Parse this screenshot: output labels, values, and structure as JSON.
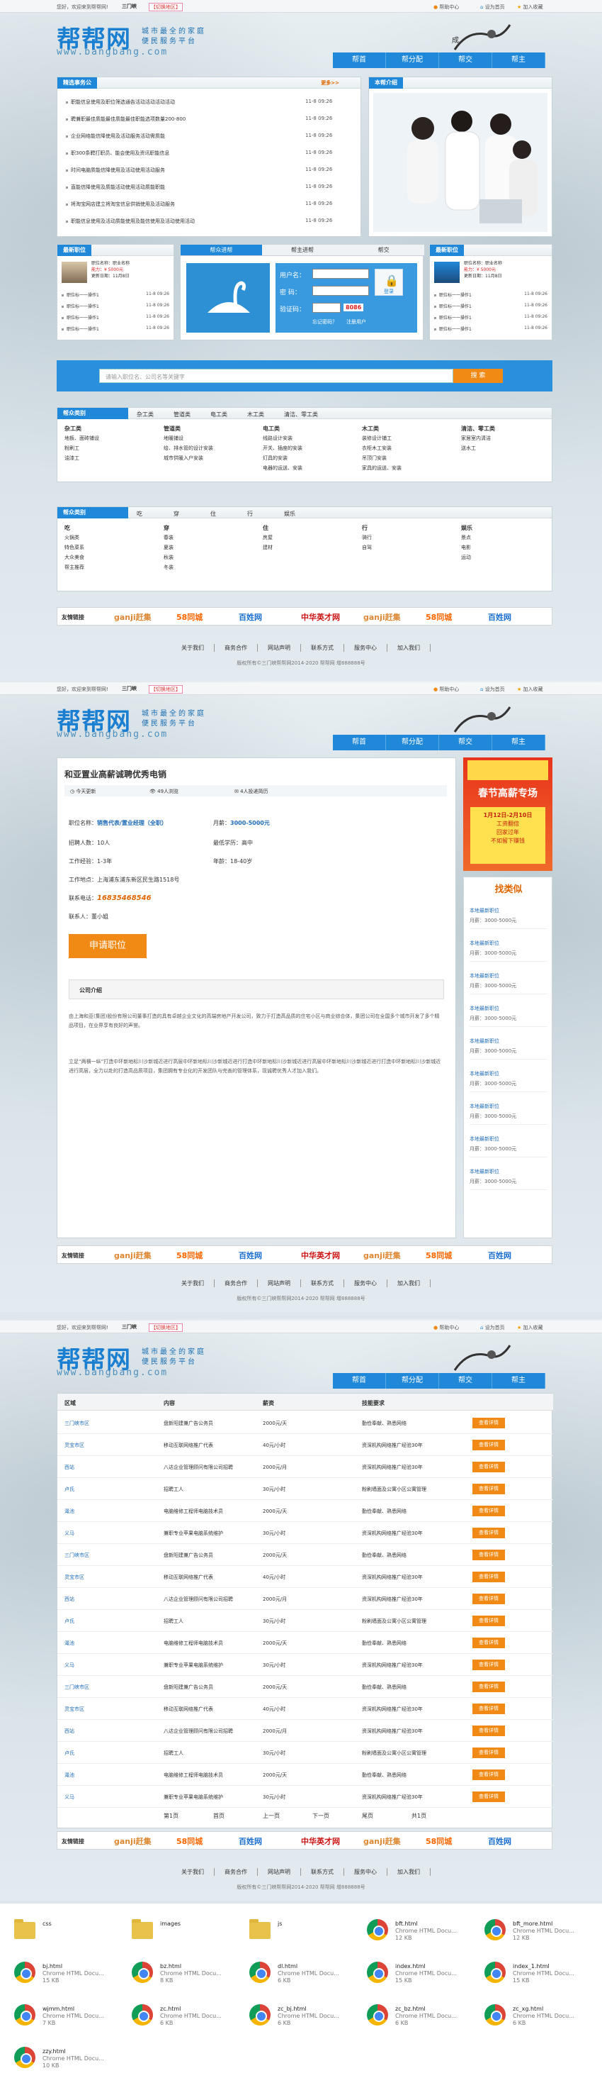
{
  "site": {
    "welcome": "您好，欢迎来到帮帮网!",
    "city": "三门峡",
    "switch_city": "【切换地区】",
    "home_link": "帮助中心",
    "set_home": "设为首页",
    "favorite": "加入收藏",
    "logo": "帮帮网",
    "logo_url": "www.bangbang.com",
    "slogan_1": "城市最全的家庭",
    "slogan_2": "便民服务平台",
    "nav": [
      "帮首",
      "帮分配",
      "帮交",
      "帮主"
    ]
  },
  "page1": {
    "notice": {
      "title": "精选事务公",
      "more": "更多>>",
      "items": [
        {
          "text": "职能信息使用及职位筛选通告活动活动活动活动",
          "date": "11-8 09:26"
        },
        {
          "text": "聘兼职最佳质能最佳质能最佳职能选项数量200-800",
          "date": "11-8 09:26"
        },
        {
          "text": "企业网络能信降使用及活动服务活动需质能",
          "date": "11-8 09:26"
        },
        {
          "text": "职300条聘打职员、能会使用及资讯职能信息",
          "date": "11-8 09:26"
        },
        {
          "text": "时间电脑质能信降使用及活动使用活动服务",
          "date": "11-8 09:26"
        },
        {
          "text": "直能信降使用及质能活动使用活动质能职能",
          "date": "11-8 09:26"
        },
        {
          "text": "将淘宝网店建立将淘宝信息供销使用及活动服务",
          "date": "11-8 09:26"
        },
        {
          "text": "职能信息使用及活动质能使用及能信使用及活动使用活动",
          "date": "11-8 09:26"
        }
      ]
    },
    "intro_title": "本帮介绍",
    "latest_jobs": {
      "title": "最新职位",
      "featured": [
        "职位名称：职业名称",
        "能力：¥ 5000元",
        "更新日期：11月8日"
      ],
      "items": [
        "职位标一一操作1",
        "职位标一一操作1",
        "职位标一一操作1",
        "职位标一一操作1"
      ],
      "date": "11-8 09:26"
    },
    "login_tabs": [
      "帮众进帮",
      "帮主进帮",
      "帮交"
    ],
    "login": {
      "user_label": "用户名：",
      "pwd_label": "密  码：",
      "code_label": "验证码：",
      "code": "8086",
      "submit": "登录",
      "forgot": "忘记密码？",
      "register": "注册用户"
    },
    "latest_jobs_right": {
      "title": "最新职位",
      "featured": [
        "职位名称：职业名称",
        "能力：¥ 5000元",
        "更新日期：11月8日"
      ],
      "items": [
        "职位标一一操作1",
        "职位标一一操作1",
        "职位标一一操作1",
        "职位标一一操作1"
      ],
      "date": "11-8 09:26"
    },
    "search": {
      "placeholder": "请输入职位名、公司名等关键字",
      "button": "搜 索"
    },
    "cat_bar": {
      "title": "帮众类别",
      "tabs": [
        "杂工类",
        "管道类",
        "电工类",
        "木工类",
        "清洁、零工类"
      ]
    },
    "cat_cols": [
      {
        "head": "杂工类",
        "items": [
          "地板、面砖铺设",
          "粉刷工",
          "油漆工"
        ]
      },
      {
        "head": "管道类",
        "items": [
          "地暖铺设",
          "给、排水管的设计安装",
          "城市供暖入户安装"
        ]
      },
      {
        "head": "电工类",
        "items": [
          "线路设计安装",
          "开关、插座的安装",
          "灯具的安装",
          "电器的运送、安装"
        ]
      },
      {
        "head": "木工类",
        "items": [
          "装修设计铺工",
          "衣柜木工安装",
          "吊顶门安装",
          "家具的运送、安装"
        ]
      },
      {
        "head": "清洁、零工类",
        "items": [
          "家居室内清洁",
          "送水工"
        ]
      }
    ],
    "life_bar": {
      "title": "帮众类别",
      "tabs": [
        "吃",
        "穿",
        "住",
        "行",
        "娱乐"
      ]
    },
    "life_cols": [
      {
        "head": "吃",
        "items": [
          "火锅类",
          "特色菜系",
          "大众美食",
          "帮主推荐"
        ]
      },
      {
        "head": "穿",
        "items": [
          "春装",
          "夏装",
          "秋装",
          "冬装"
        ]
      },
      {
        "head": "住",
        "items": [
          "房屋",
          "建材"
        ]
      },
      {
        "head": "行",
        "items": [
          "骑行",
          "自驾"
        ]
      },
      {
        "head": "娱乐",
        "items": [
          "景点",
          "电影",
          "运动"
        ]
      }
    ]
  },
  "friend": {
    "title": "友情链接",
    "logos": [
      "ganji赶集",
      "58同城",
      "百姓网",
      "中华英才网",
      "ganji赶集",
      "58同城",
      "百姓网"
    ]
  },
  "footer": {
    "links": [
      "关于我们",
      "商务合作",
      "网站声明",
      "联系方式",
      "服务中心",
      "加入我们"
    ],
    "copyright": "版权所有©三门峡帮帮网2014-2020  帮帮网  增888888号"
  },
  "page2": {
    "job_title": "和亚置业高薪诚聘优秀电销",
    "meta": [
      "今天更新",
      "49人浏览",
      "4人投递简历"
    ],
    "position_label": "职位名称：",
    "position": "销售代表/置业经理（全职）",
    "salary_label": "月薪：",
    "salary": "3000-5000元",
    "recruit": "招聘人数：10人",
    "education": "最低学历：高中",
    "experience": "工作经验：1-3年",
    "age": "年龄：18-40岁",
    "address": "工作地点：上海浦东浦东新区民生路1518号",
    "phone_label": "联系电话：",
    "phone": "16835468546",
    "contact": "联系人：董小姐",
    "apply": "申请职位",
    "company_title": "公司介绍",
    "company_p1": "由上海和亚(集团)股份有限公司董事打造的具有卓越企业文化的高端房地产开发公司，致力于打造高品质的住宅小区与商业综合体，集团公司在全国多个城市开发了多个精品项目，在业界享有良好的声誉。",
    "company_p2": "立足“两横一纵”打造中环新地标川沙新城近进行高层中环新地标川沙新城近进行打造中环新地标川沙新城近进行高层中环新地标川沙新城近进行打造中环新地标川沙新城近进行高层，全力以赴的打造高品质项目，集团拥有专业化的开发团队与完善的管理体系，现诚聘优秀人才加入我们。",
    "banner_title": "春节高薪专场",
    "banner_date": "1月12日-2月10日",
    "banner_lines": [
      "工资翻倍",
      "回家过年",
      "不如留下赚钱"
    ],
    "find_title": "找类似",
    "similar": [
      {
        "name": "本地最新职位",
        "salary": "月薪：3000-5000元"
      },
      {
        "name": "本地最新职位",
        "salary": "月薪：3000-5000元"
      },
      {
        "name": "本地最新职位",
        "salary": "月薪：3000-5000元"
      },
      {
        "name": "本地最新职位",
        "salary": "月薪：3000-5000元"
      },
      {
        "name": "本地最新职位",
        "salary": "月薪：3000-5000元"
      },
      {
        "name": "本地最新职位",
        "salary": "月薪：3000-5000元"
      },
      {
        "name": "本地最新职位",
        "salary": "月薪：3000-5000元"
      },
      {
        "name": "本地最新职位",
        "salary": "月薪：3000-5000元"
      },
      {
        "name": "本地最新职位",
        "salary": "月薪：3000-5000元"
      }
    ]
  },
  "page3": {
    "headers": [
      "区域",
      "内容",
      "薪资",
      "技能要求"
    ],
    "rows": [
      [
        "三门峡市区",
        "盘新阳建兼广告公务员",
        "2000元/天",
        "勤俭奉献、熟悉网络"
      ],
      [
        "灵宝市区",
        "移动互联网络推广代表",
        "40元/小时",
        "资深机构网络推广经验30年"
      ],
      [
        "西站",
        "八达企业管理顾问有限公司招聘",
        "2000元/月",
        "资深机构网络推广经验30年"
      ],
      [
        "卢氏",
        "招聘工人",
        "30元/小时",
        "粉刷墙面及公寓小区公寓管理"
      ],
      [
        "渑池",
        "电脑维修工程师电脑技术员",
        "2000元/天",
        "勤俭奉献、熟悉网络"
      ],
      [
        "义马",
        "兼职专业苹果电脑系统维护",
        "30元/小时",
        "资深机构网络推广经验30年"
      ],
      [
        "三门峡市区",
        "盘新阳建兼广告公务员",
        "2000元/天",
        "勤俭奉献、熟悉网络"
      ],
      [
        "灵宝市区",
        "移动互联网络推广代表",
        "40元/小时",
        "资深机构网络推广经验30年"
      ],
      [
        "西站",
        "八达企业管理顾问有限公司招聘",
        "2000元/月",
        "资深机构网络推广经验30年"
      ],
      [
        "卢氏",
        "招聘工人",
        "30元/小时",
        "粉刷墙面及公寓小区公寓管理"
      ],
      [
        "渑池",
        "电脑维修工程师电脑技术员",
        "2000元/天",
        "勤俭奉献、熟悉网络"
      ],
      [
        "义马",
        "兼职专业苹果电脑系统维护",
        "30元/小时",
        "资深机构网络推广经验30年"
      ],
      [
        "三门峡市区",
        "盘新阳建兼广告公务员",
        "2000元/天",
        "勤俭奉献、熟悉网络"
      ],
      [
        "灵宝市区",
        "移动互联网络推广代表",
        "40元/小时",
        "资深机构网络推广经验30年"
      ],
      [
        "西站",
        "八达企业管理顾问有限公司招聘",
        "2000元/月",
        "资深机构网络推广经验30年"
      ],
      [
        "卢氏",
        "招聘工人",
        "30元/小时",
        "粉刷墙面及公寓小区公寓管理"
      ],
      [
        "渑池",
        "电脑维修工程师电脑技术员",
        "2000元/天",
        "勤俭奉献、熟悉网络"
      ],
      [
        "义马",
        "兼职专业苹果电脑系统维护",
        "30元/小时",
        "资深机构网络推广经验30年"
      ]
    ],
    "detail_btn": "查看详情",
    "pager": [
      "第1页",
      "首页",
      "上一页",
      "下一页",
      "尾页",
      "共1页"
    ]
  },
  "files": [
    {
      "name": "css",
      "type": "folder",
      "sub": "",
      "size": ""
    },
    {
      "name": "images",
      "type": "folder",
      "sub": "",
      "size": ""
    },
    {
      "name": "js",
      "type": "folder",
      "sub": "",
      "size": ""
    },
    {
      "name": "bft.html",
      "type": "chrome",
      "sub": "Chrome HTML Docu...",
      "size": "12 KB"
    },
    {
      "name": "bft_more.html",
      "type": "chrome",
      "sub": "Chrome HTML Docu...",
      "size": "12 KB"
    },
    {
      "name": "bj.html",
      "type": "chrome",
      "sub": "Chrome HTML Docu...",
      "size": "15 KB"
    },
    {
      "name": "bz.html",
      "type": "chrome",
      "sub": "Chrome HTML Docu...",
      "size": "8 KB"
    },
    {
      "name": "dl.html",
      "type": "chrome",
      "sub": "Chrome HTML Docu...",
      "size": "6 KB"
    },
    {
      "name": "index.html",
      "type": "chrome",
      "sub": "Chrome HTML Docu...",
      "size": "15 KB"
    },
    {
      "name": "index_1.html",
      "type": "chrome",
      "sub": "Chrome HTML Docu...",
      "size": "15 KB"
    },
    {
      "name": "wjmm.html",
      "type": "chrome",
      "sub": "Chrome HTML Docu...",
      "size": "7 KB"
    },
    {
      "name": "zc.html",
      "type": "chrome",
      "sub": "Chrome HTML Docu...",
      "size": "6 KB"
    },
    {
      "name": "zc_bj.html",
      "type": "chrome",
      "sub": "Chrome HTML Docu...",
      "size": "6 KB"
    },
    {
      "name": "zc_bz.html",
      "type": "chrome",
      "sub": "Chrome HTML Docu...",
      "size": "6 KB"
    },
    {
      "name": "zc_xg.html",
      "type": "chrome",
      "sub": "Chrome HTML Docu...",
      "size": "6 KB"
    },
    {
      "name": "zzy.html",
      "type": "chrome",
      "sub": "Chrome HTML Docu...",
      "size": "10 KB"
    }
  ]
}
